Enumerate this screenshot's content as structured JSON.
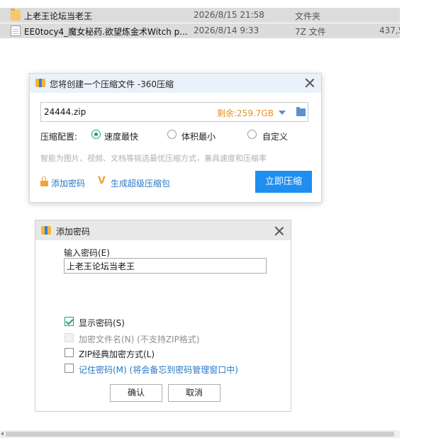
{
  "file_list": [
    {
      "name": "上老王论坛当老王",
      "date": "2026/8/15 21:58",
      "type": "文件夹",
      "size": "",
      "icon": "folder-icon"
    },
    {
      "name": "EE0tocy4_魔女秘药.欲望炼金术Witch p...",
      "date": "2026/8/14 9:33",
      "type": "7Z 文件",
      "size": "437,5",
      "icon": "document-icon"
    }
  ],
  "compress_dialog": {
    "title": "您将创建一个压缩文件 -360压缩",
    "filename": "24444.zip",
    "free_space": "剩余:259.7GB",
    "config_label": "压缩配置:",
    "options": [
      {
        "label": "速度最快",
        "selected": true
      },
      {
        "label": "体积最小",
        "selected": false
      },
      {
        "label": "自定义",
        "selected": false
      }
    ],
    "hint": "智能为图片、视频、文档等挑选最优压缩方式，兼具速度和压缩率",
    "add_password_label": "添加密码",
    "sfx_label": "生成超级压缩包",
    "compress_button": "立即压缩",
    "accent_color": "#1e8ef0"
  },
  "password_dialog": {
    "title": "添加密码",
    "input_label": "输入密码(E)",
    "password_value": "上老王论坛当老王",
    "options": [
      {
        "label": "显示密码(S)",
        "checked": true,
        "disabled": false
      },
      {
        "label": "加密文件名(N) (不支持ZIP格式)",
        "checked": false,
        "disabled": true
      },
      {
        "label": "ZIP经典加密方式(L)",
        "checked": false,
        "disabled": false
      },
      {
        "label": "记住密码(M) (将会备忘到密码管理窗口中)",
        "checked": false,
        "disabled": false
      }
    ],
    "ok_button": "确认",
    "cancel_button": "取消"
  }
}
